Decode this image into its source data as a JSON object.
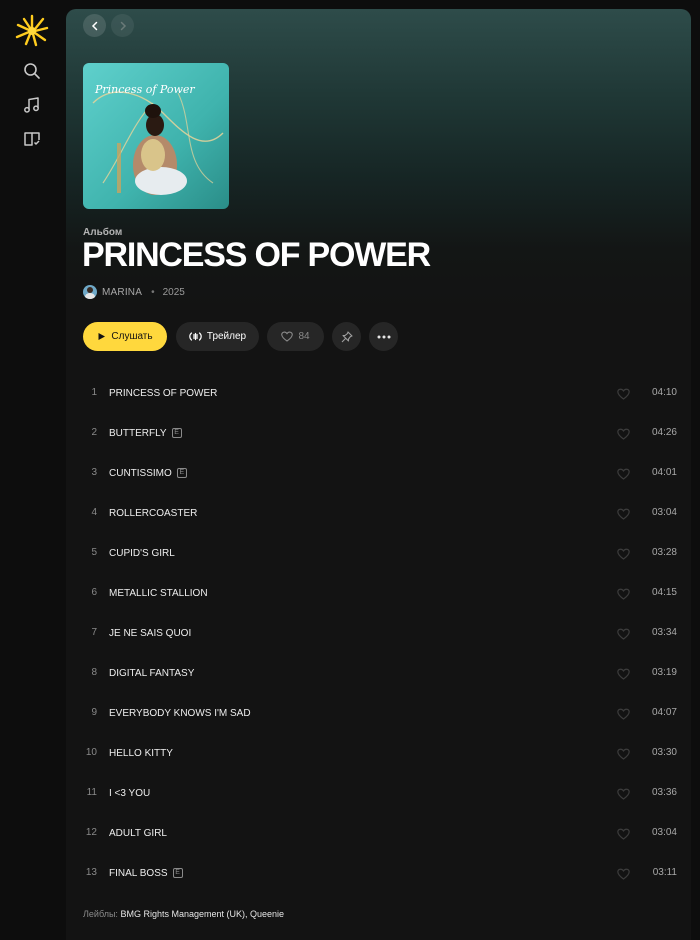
{
  "sidebar": {
    "logo": "sunburst-logo",
    "items": [
      {
        "name": "search",
        "icon": "search-icon"
      },
      {
        "name": "music",
        "icon": "music-note-icon"
      },
      {
        "name": "library",
        "icon": "library-icon"
      }
    ]
  },
  "nav": {
    "back_icon": "chevron-left-icon",
    "forward_icon": "chevron-right-icon"
  },
  "album": {
    "type": "Альбом",
    "title": "PRINCESS OF POWER",
    "artist": "MARINA",
    "year": "2025",
    "cover_text": "Princess of Power"
  },
  "actions": {
    "play_label": "Слушать",
    "trailer_label": "Трейлер",
    "likes": "84"
  },
  "tracks": [
    {
      "num": "1",
      "title": "PRINCESS OF POWER",
      "explicit": false,
      "duration": "04:10"
    },
    {
      "num": "2",
      "title": "BUTTERFLY",
      "explicit": true,
      "duration": "04:26"
    },
    {
      "num": "3",
      "title": "CUNTISSIMO",
      "explicit": true,
      "duration": "04:01"
    },
    {
      "num": "4",
      "title": "ROLLERCOASTER",
      "explicit": false,
      "duration": "03:04"
    },
    {
      "num": "5",
      "title": "CUPID'S GIRL",
      "explicit": false,
      "duration": "03:28"
    },
    {
      "num": "6",
      "title": "METALLIC STALLION",
      "explicit": false,
      "duration": "04:15"
    },
    {
      "num": "7",
      "title": "JE NE SAIS QUOI",
      "explicit": false,
      "duration": "03:34"
    },
    {
      "num": "8",
      "title": "DIGITAL FANTASY",
      "explicit": false,
      "duration": "03:19"
    },
    {
      "num": "9",
      "title": "EVERYBODY KNOWS I'M SAD",
      "explicit": false,
      "duration": "04:07"
    },
    {
      "num": "10",
      "title": "HELLO KITTY",
      "explicit": false,
      "duration": "03:30"
    },
    {
      "num": "11",
      "title": "I <3 YOU",
      "explicit": false,
      "duration": "03:36"
    },
    {
      "num": "12",
      "title": "ADULT GIRL",
      "explicit": false,
      "duration": "03:04"
    },
    {
      "num": "13",
      "title": "FINAL BOSS",
      "explicit": true,
      "duration": "03:11"
    }
  ],
  "explicit_badge": "E",
  "labels": {
    "prefix": "Лейблы:",
    "names": "BMG Rights Management (UK), Queenie"
  },
  "colors": {
    "accent": "#ffd83d",
    "background": "#0d0d0d",
    "header_gradient": "#2e4c4a"
  }
}
